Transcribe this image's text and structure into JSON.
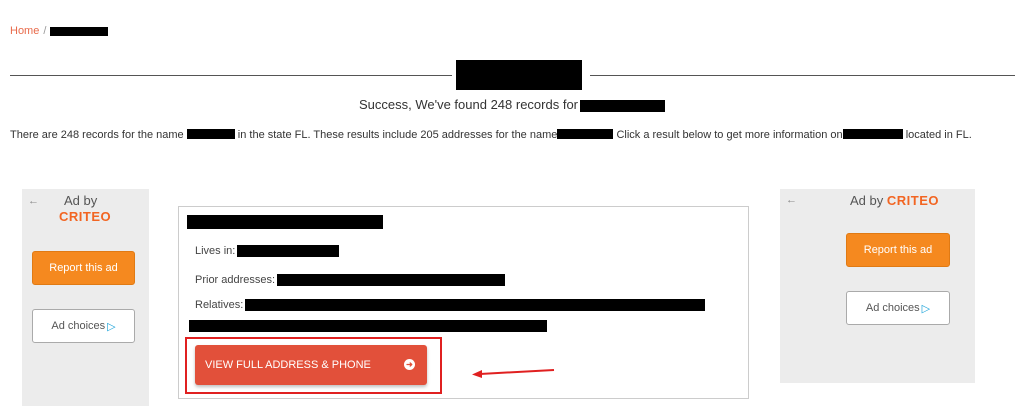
{
  "breadcrumb": {
    "home": "Home",
    "separator": "/"
  },
  "success": {
    "text": "Success, We've found 248 records for"
  },
  "intro": {
    "part1": "There are 248 records for the name",
    "part2": "in the state FL. These results include 205 addresses for the name",
    "part3": "Click a result below to get more information on",
    "part4": "located in FL."
  },
  "ad_left": {
    "back": "←",
    "ad_by": "Ad by",
    "brand": "CRITEO",
    "report": "Report this ad",
    "choices": "Ad choices",
    "choices_icon": "▷"
  },
  "ad_right": {
    "back": "←",
    "ad_by": "Ad by",
    "brand": "CRITEO",
    "report": "Report this ad",
    "choices": "Ad choices",
    "choices_icon": "▷"
  },
  "result": {
    "lives_in_label": "Lives in:",
    "prior_label": "Prior addresses:",
    "relatives_label": "Relatives:",
    "view_button": "VIEW FULL ADDRESS & PHONE",
    "view_icon": "➜"
  },
  "colors": {
    "accent": "#e2503a",
    "criteo": "#f26522",
    "report": "#f5891f",
    "annotation": "#e02020"
  }
}
